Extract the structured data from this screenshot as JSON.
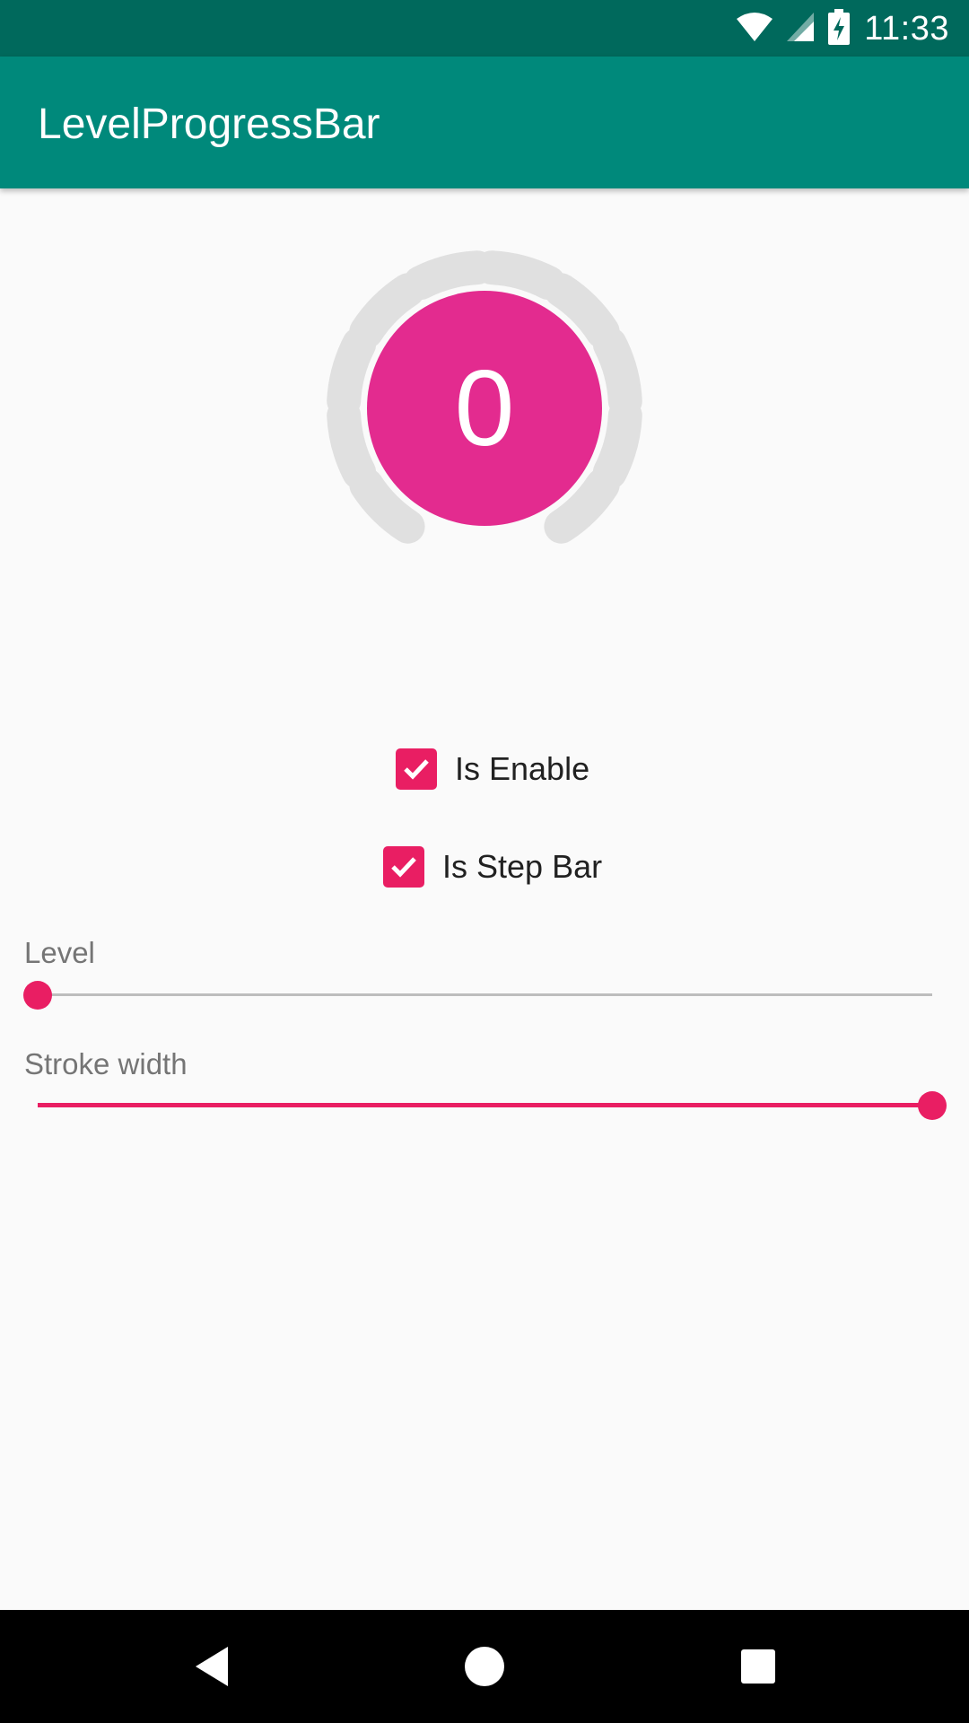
{
  "status_bar": {
    "time": "11:33",
    "icons": [
      "wifi-icon",
      "cell-signal-icon",
      "battery-charging-icon"
    ]
  },
  "app_bar": {
    "title": "LevelProgressBar"
  },
  "level_progress": {
    "value": "0",
    "segments_total": 12,
    "segments_filled": 0,
    "accent_color": "#e32b8f",
    "segment_color": "#e0e0e0"
  },
  "checkboxes": {
    "is_enable": {
      "label": "Is Enable",
      "checked": true
    },
    "is_step_bar": {
      "label": "Is Step Bar",
      "checked": true
    }
  },
  "sliders": {
    "level": {
      "label": "Level",
      "fraction": 0.0
    },
    "stroke_width": {
      "label": "Stroke width",
      "fraction": 1.0
    }
  },
  "colors": {
    "status_bar": "#00695c",
    "app_bar": "#00897b",
    "accent": "#e91e63",
    "background": "#fafafa"
  },
  "nav_bar": {
    "buttons": [
      "back-icon",
      "home-icon",
      "recents-icon"
    ]
  }
}
